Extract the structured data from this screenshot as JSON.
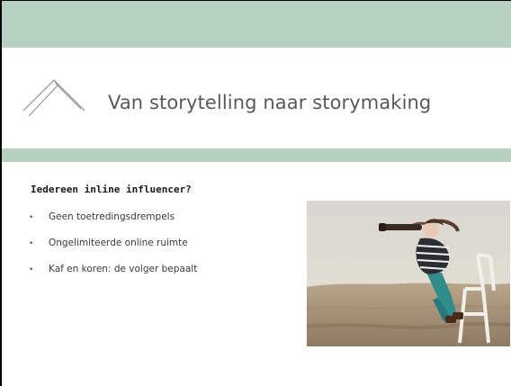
{
  "slide": {
    "title": "Van storytelling naar storymaking",
    "subheading": "Iedereen inline influencer?",
    "bullets": [
      {
        "marker": "•",
        "text": "Geen toetredingsdrempels"
      },
      {
        "marker": "•",
        "text": "Ongelimiteerde online ruimte"
      },
      {
        "marker": "•",
        "text": "Kaf en koren: de volger bepaalt"
      }
    ]
  },
  "icons": {
    "logo": "house-outline-icon",
    "photo": "girl-with-telescope-on-chair-photo"
  },
  "colors": {
    "band": "#b7d1c1",
    "title": "#595959",
    "text": "#3a3a3a",
    "heading": "#1a1a1a"
  }
}
